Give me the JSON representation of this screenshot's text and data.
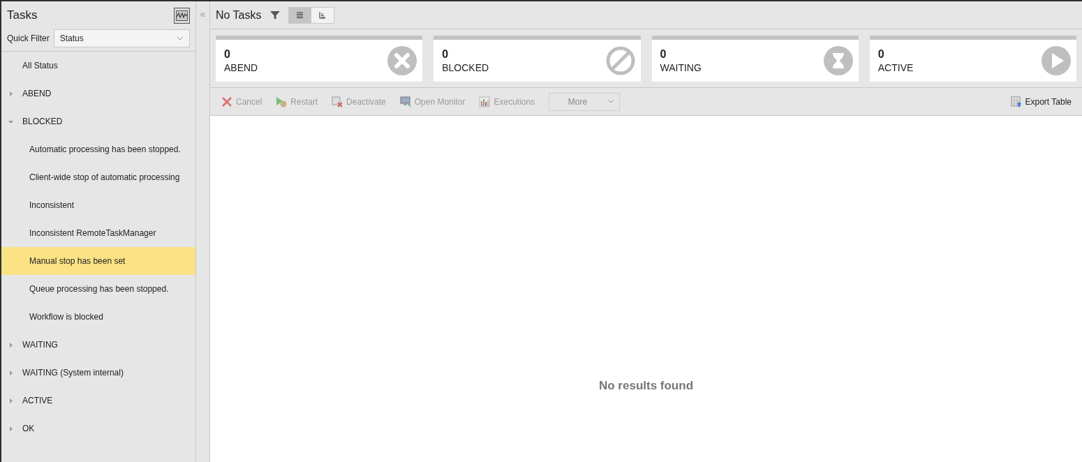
{
  "sidebar": {
    "title": "Tasks",
    "quick_filter": {
      "label": "Quick Filter",
      "value": "Status"
    },
    "tree": [
      {
        "label": "All Status",
        "selected": false
      },
      {
        "label": "ABEND",
        "expandable": true,
        "expanded": false,
        "selected": false
      },
      {
        "label": "BLOCKED",
        "expandable": true,
        "expanded": true,
        "selected": false,
        "children": [
          {
            "label": "Automatic processing has been stopped.",
            "selected": false
          },
          {
            "label": "Client-wide stop of automatic processing",
            "selected": false
          },
          {
            "label": "Inconsistent",
            "selected": false
          },
          {
            "label": "Inconsistent RemoteTaskManager",
            "selected": false
          },
          {
            "label": "Manual stop has been set",
            "selected": true
          },
          {
            "label": "Queue processing has been stopped.",
            "selected": false
          },
          {
            "label": "Workflow is blocked",
            "selected": false
          }
        ]
      },
      {
        "label": "WAITING",
        "expandable": true,
        "expanded": false,
        "selected": false
      },
      {
        "label": "WAITING (System internal)",
        "expandable": true,
        "expanded": false,
        "selected": false
      },
      {
        "label": "ACTIVE",
        "expandable": true,
        "expanded": false,
        "selected": false
      },
      {
        "label": "OK",
        "expandable": true,
        "expanded": false,
        "selected": false
      }
    ]
  },
  "collapse_handle": "«",
  "header": {
    "title": "No Tasks",
    "views": [
      {
        "kind": "list",
        "selected": true
      },
      {
        "kind": "tree",
        "selected": false
      }
    ]
  },
  "tiles": [
    {
      "count": "0",
      "label": "ABEND",
      "kind": "abend"
    },
    {
      "count": "0",
      "label": "BLOCKED",
      "kind": "blocked"
    },
    {
      "count": "0",
      "label": "WAITING",
      "kind": "waiting"
    },
    {
      "count": "0",
      "label": "ACTIVE",
      "kind": "active"
    }
  ],
  "toolbar": [
    {
      "label": "Cancel",
      "kind": "cancel",
      "disabled": true
    },
    {
      "label": "Restart",
      "kind": "restart",
      "disabled": true
    },
    {
      "label": "Deactivate",
      "kind": "deactivate",
      "disabled": true
    },
    {
      "label": "Open Monitor",
      "kind": "monitor",
      "disabled": true
    },
    {
      "label": "Executions",
      "kind": "executions",
      "disabled": true
    },
    {
      "label": "More",
      "kind": "more",
      "disabled": true
    }
  ],
  "export_button": {
    "label": "Export Table",
    "disabled": false
  },
  "empty_message": "No results found"
}
